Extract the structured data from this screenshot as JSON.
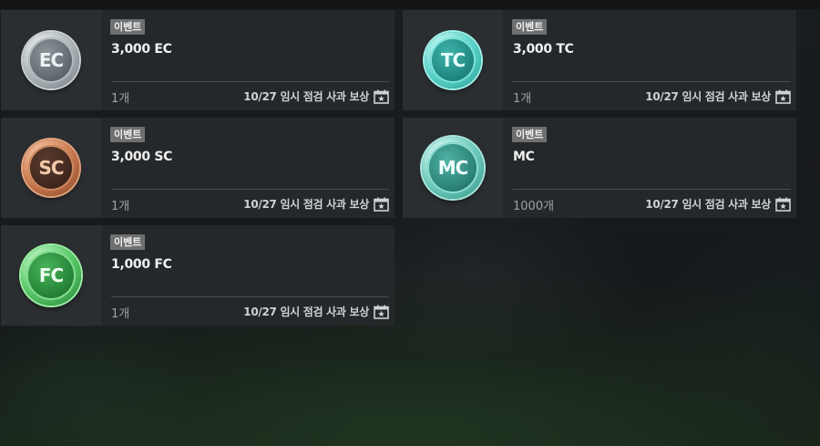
{
  "items": [
    {
      "tag": "이벤트",
      "coin_text": "EC",
      "coin_icon": "ec-coin-icon",
      "name": "3,000 EC",
      "quantity": "1개",
      "source": "10/27 임시 점검 사과 보상",
      "status_icon": "calendar-star-icon"
    },
    {
      "tag": "이벤트",
      "coin_text": "TC",
      "coin_icon": "tc-coin-icon",
      "name": "3,000 TC",
      "quantity": "1개",
      "source": "10/27 임시 점검 사과 보상",
      "status_icon": "calendar-star-icon"
    },
    {
      "tag": "이벤트",
      "coin_text": "SC",
      "coin_icon": "sc-coin-icon",
      "name": "3,000 SC",
      "quantity": "1개",
      "source": "10/27 임시 점검 사과 보상",
      "status_icon": "calendar-star-icon"
    },
    {
      "tag": "이벤트",
      "coin_text": "MC",
      "coin_icon": "mc-coin-icon",
      "name": "MC",
      "quantity": "1000개",
      "source": "10/27 임시 점검 사과 보상",
      "status_icon": "calendar-star-icon"
    },
    {
      "tag": "이벤트",
      "coin_text": "FC",
      "coin_icon": "fc-coin-icon",
      "name": "1,000 FC",
      "quantity": "1개",
      "source": "10/27 임시 점검 사과 보상",
      "status_icon": "calendar-star-icon"
    }
  ],
  "colors": {
    "tag_bg": "#6e6f70",
    "card_bg": "#26292c",
    "text_primary": "#f0f0f0",
    "text_secondary": "#9ea2a5"
  }
}
